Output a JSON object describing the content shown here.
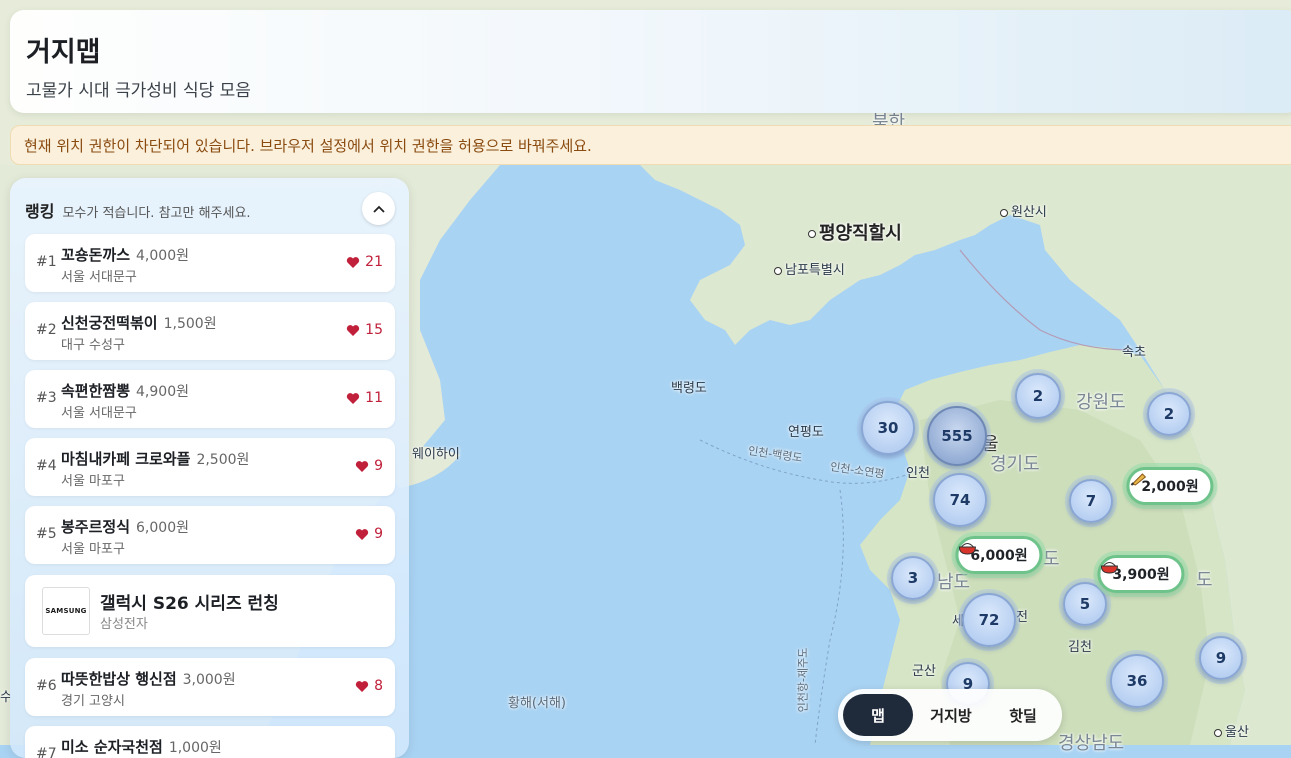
{
  "app": {
    "title": "거지맵",
    "subtitle": "고물가 시대 극가성비 식당 모음"
  },
  "warning": "현재 위치 권한이 차단되어 있습니다. 브라우저 설정에서 위치 권한을 허용으로 바꿔주세요.",
  "ranking": {
    "title": "랭킹",
    "note": "모수가 적습니다. 참고만 해주세요.",
    "items": [
      {
        "rank": "#1",
        "name": "꼬숑돈까스",
        "price": "4,000원",
        "address": "서울 서대문구",
        "likes": "21"
      },
      {
        "rank": "#2",
        "name": "신천궁전떡볶이",
        "price": "1,500원",
        "address": "대구 수성구",
        "likes": "15"
      },
      {
        "rank": "#3",
        "name": "속편한짬뽕",
        "price": "4,900원",
        "address": "서울 서대문구",
        "likes": "11"
      },
      {
        "rank": "#4",
        "name": "마침내카페 크로와플",
        "price": "2,500원",
        "address": "서울 마포구",
        "likes": "9"
      },
      {
        "rank": "#5",
        "name": "봉주르정식",
        "price": "6,000원",
        "address": "서울 마포구",
        "likes": "9"
      },
      {
        "rank": "#6",
        "name": "따뜻한밥상 행신점",
        "price": "3,000원",
        "address": "경기 고양시",
        "likes": "8"
      },
      {
        "rank": "#7",
        "name": "미소 순자국천점",
        "price": "1,000원",
        "address": "",
        "likes": ""
      }
    ],
    "ad": {
      "logo": "SAMSUNG",
      "title": "갤럭시 S26 시리즈 런칭",
      "brand": "삼성전자"
    }
  },
  "map": {
    "places": {
      "pyongyang": "평양직할시",
      "wonsan": "원산시",
      "nampo": "남포특별시",
      "sokcho": "속초",
      "gangwon": "강원도",
      "gyeonggi": "경기도",
      "baengnyeong": "백령도",
      "yeonpyeong": "연평도",
      "incheon": "인천",
      "route1": "인천-백령도",
      "route2": "인천-소연평",
      "route3": "인천항-제주도",
      "weihai": "웨이하이",
      "yellow_sea": "황해(서해)",
      "gunsan": "군산",
      "gimcheon": "김천",
      "ulsan": "울산",
      "north": "북한",
      "seoul_frag": "울",
      "south_frag": "남도",
      "do_frag": "도",
      "do_frag2": "도",
      "sejong_frag": "세",
      "jeon_frag": "전",
      "gyeongsang": "경상남도",
      "edge_frag": "수"
    },
    "clusters": {
      "c555": "555",
      "c30": "30",
      "c74": "74",
      "c72": "72",
      "c3": "3",
      "c2a": "2",
      "c2b": "2",
      "c7": "7",
      "c5": "5",
      "c36": "36",
      "c9a": "9",
      "c9b": "9"
    },
    "price_markers": {
      "p2000": "2,000원",
      "p6000": "6,000원",
      "p3900": "3,900원"
    }
  },
  "tabs": [
    "맵",
    "거지방",
    "핫딜"
  ],
  "colors": {
    "accent_dark": "#1f2a3a",
    "heart": "#c0203a",
    "marker_border": "#6ec38b",
    "warning_text": "#8a4b10"
  }
}
